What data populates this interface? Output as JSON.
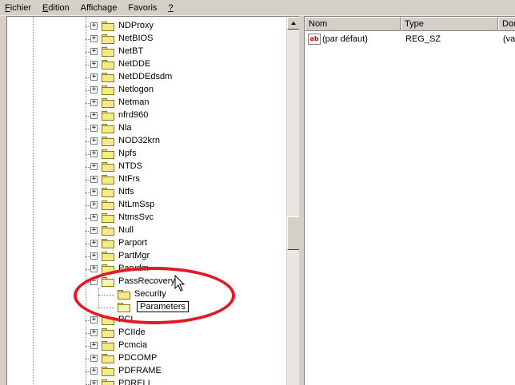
{
  "menu": {
    "items": [
      {
        "label_u": "F",
        "label_rest": "ichier"
      },
      {
        "label_u": "E",
        "label_rest": "dition"
      },
      {
        "label_u": "A",
        "label_rest": "ffichage"
      },
      {
        "label_u": "F",
        "label_rest": "avoris"
      },
      {
        "label_u": "?",
        "label_rest": ""
      }
    ]
  },
  "tree": {
    "items": [
      {
        "label": "NDProxy"
      },
      {
        "label": "NetBIOS"
      },
      {
        "label": "NetBT"
      },
      {
        "label": "NetDDE"
      },
      {
        "label": "NetDDEdsdm"
      },
      {
        "label": "Netlogon"
      },
      {
        "label": "Netman"
      },
      {
        "label": "nfrd960"
      },
      {
        "label": "Nla"
      },
      {
        "label": "NOD32krn"
      },
      {
        "label": "Npfs"
      },
      {
        "label": "NTDS"
      },
      {
        "label": "NtFrs"
      },
      {
        "label": "Ntfs"
      },
      {
        "label": "NtLmSsp"
      },
      {
        "label": "NtmsSvc"
      },
      {
        "label": "Null"
      },
      {
        "label": "Parport"
      },
      {
        "label": "PartMgr"
      },
      {
        "label": "Parvdm"
      },
      {
        "label": "PassRecovery"
      },
      {
        "label": "PCI"
      },
      {
        "label": "PCIIde"
      },
      {
        "label": "Pcmcia"
      },
      {
        "label": "PDCOMP"
      },
      {
        "label": "PDFRAME"
      },
      {
        "label": "PDRELI"
      }
    ],
    "children": [
      {
        "label": "Security"
      },
      {
        "label": "Parameters"
      }
    ],
    "expander_collapsed": "+",
    "expander_expanded": "−"
  },
  "list": {
    "columns": [
      "Nom",
      "Type",
      "Don"
    ],
    "rows": [
      {
        "name": "(par défaut)",
        "type": "REG_SZ",
        "data": "(val"
      }
    ],
    "value_icon_text": "ab"
  },
  "colors": {
    "annotation_circle": "#e01b24",
    "folder": "#f6e98a"
  }
}
